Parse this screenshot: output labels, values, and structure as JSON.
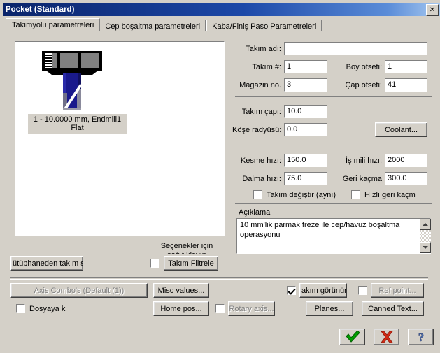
{
  "window": {
    "title": "Pocket (Standard)",
    "close_label": "✕"
  },
  "tabs": [
    {
      "label": "Takımyolu parametreleri",
      "active": true
    },
    {
      "label": "Cep boşaltma parametreleri",
      "active": false
    },
    {
      "label": "Kaba/Finiş Paso Parametreleri",
      "active": false
    }
  ],
  "tool_list": {
    "caption_line1": "1 - 10.0000 mm, Endmill1",
    "caption_line2": "Flat"
  },
  "fields": {
    "tool_name_label": "Takım adı:",
    "tool_name_value": "",
    "tool_number_label": "Takım #:",
    "tool_number_value": "1",
    "length_offset_label": "Boy ofseti:",
    "length_offset_value": "1",
    "magazine_label": "Magazin no.",
    "magazine_value": "3",
    "diameter_offset_label": "Çap ofseti:",
    "diameter_offset_value": "41",
    "tool_diameter_label": "Takım çapı:",
    "tool_diameter_value": "10.0",
    "corner_radius_label": "Köşe radyüsü:",
    "corner_radius_value": "0.0",
    "coolant_button": "Coolant...",
    "feed_rate_label": "Kesme hızı:",
    "feed_rate_value": "150.0",
    "spindle_speed_label": "İş mili hızı:",
    "spindle_speed_value": "2000",
    "plunge_rate_label": "Dalma hızı:",
    "plunge_rate_value": "75.0",
    "retract_rate_label": "Geri kaçma",
    "retract_rate_value": "300.0",
    "tool_change_label": "Takım değiştir (aynı)",
    "tool_change_checked": false,
    "rapid_retract_label": "Hızlı geri kaçm",
    "rapid_retract_checked": false
  },
  "comment": {
    "group_title": "Açıklama",
    "text": "10 mm'lik parmak freze ile cep/havuz boşaltma operasyonu",
    "scroll_up_icon": "scroll-up-arrow",
    "scroll_down_icon": "scroll-down-arrow"
  },
  "bottom": {
    "tool_library_button": "ütüphaneden takım s",
    "options_hint_line1": "Seçenekler için",
    "options_hint_line2": "sağ tıklayın",
    "tool_filter_checked": false,
    "tool_filter_button": "Takım Filtrele",
    "axis_combos_button": "Axis Combo's (Default (1))",
    "axis_combos_disabled": true,
    "save_to_file_label": "Dosyaya k",
    "save_to_file_checked": false,
    "misc_values_button": "Misc values...",
    "home_pos_button": "Home pos...",
    "rotary_axis_checked": false,
    "rotary_axis_button": "Rotary axis...",
    "rotary_axis_disabled": true,
    "tool_display_checked": true,
    "tool_display_button": "akım görünümü",
    "ref_point_checked": false,
    "ref_point_button": "Ref point...",
    "ref_point_disabled": true,
    "planes_button": "Planes...",
    "canned_text_button": "Canned Text..."
  },
  "footer": {
    "ok_icon": "check-mark-icon",
    "cancel_icon": "red-x-icon",
    "help_icon": "question-mark-icon"
  },
  "colors": {
    "titlebar_start": "#0a246a",
    "titlebar_end": "#a6c8f0",
    "dialog_face": "#d4d0c8",
    "ok_green": "#00a000",
    "cancel_red": "#d42a15",
    "help_blue": "#3a5a9c",
    "tool_body_blue": "#1a1a8c"
  }
}
